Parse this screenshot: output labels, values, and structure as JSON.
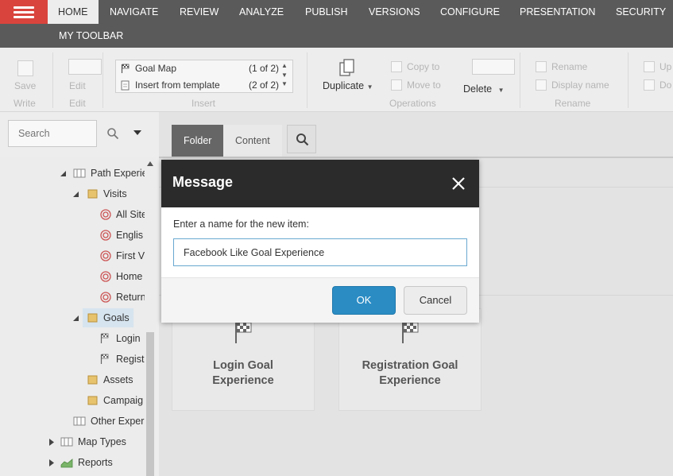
{
  "topbar": {
    "tabs": [
      "HOME",
      "NAVIGATE",
      "REVIEW",
      "ANALYZE",
      "PUBLISH",
      "VERSIONS",
      "CONFIGURE",
      "PRESENTATION",
      "SECURITY"
    ],
    "active_tab": "HOME",
    "my_toolbar": "MY TOOLBAR"
  },
  "ribbon": {
    "write": {
      "save_label": "Save",
      "group_label": "Write"
    },
    "edit": {
      "edit_label": "Edit",
      "group_label": "Edit"
    },
    "insert": {
      "items": [
        {
          "label": "Goal Map",
          "count": "(1 of 2)"
        },
        {
          "label": "Insert from template",
          "count": "(2 of 2)"
        }
      ],
      "group_label": "Insert"
    },
    "operations": {
      "duplicate_label": "Duplicate",
      "copy_to_label": "Copy to",
      "move_to_label": "Move to",
      "delete_label": "Delete",
      "group_label": "Operations"
    },
    "rename": {
      "rename_label": "Rename",
      "display_name_label": "Display name",
      "group_label": "Rename"
    },
    "partial": {
      "up_label": "Up",
      "down_label": "Do"
    }
  },
  "sidebar": {
    "search_placeholder": "Search",
    "tree": [
      {
        "label": "Path Experie",
        "icon": "path-map-icon"
      },
      {
        "label": "Visits",
        "icon": "folder-icon"
      },
      {
        "label": "All Site",
        "icon": "target-icon"
      },
      {
        "label": "Englis",
        "icon": "target-icon"
      },
      {
        "label": "First V",
        "icon": "target-icon"
      },
      {
        "label": "Home",
        "icon": "target-icon"
      },
      {
        "label": "Return",
        "icon": "target-icon"
      },
      {
        "label": "Goals",
        "icon": "folder-icon"
      },
      {
        "label": "Login",
        "icon": "flag-icon"
      },
      {
        "label": "Regist",
        "icon": "flag-icon"
      },
      {
        "label": "Assets",
        "icon": "folder-icon"
      },
      {
        "label": "Campaig",
        "icon": "folder-icon"
      },
      {
        "label": "Other Experi",
        "icon": "path-map-icon"
      },
      {
        "label": "Map Types",
        "icon": "path-map-icon"
      },
      {
        "label": "Reports",
        "icon": "chart-icon"
      }
    ]
  },
  "main": {
    "tabs": [
      "Folder",
      "Content"
    ],
    "active_tab": "Folder",
    "cards": [
      {
        "title_line1": "Login Goal",
        "title_line2": "Experience"
      },
      {
        "title_line1": "Registration Goal",
        "title_line2": "Experience"
      }
    ]
  },
  "modal": {
    "title": "Message",
    "prompt": "Enter a name for the new item:",
    "input_value": "Facebook Like Goal Experience",
    "ok_label": "OK",
    "cancel_label": "Cancel"
  },
  "colors": {
    "accent_red": "#d9443d",
    "topbar_gray": "#5a5a5a",
    "modal_header": "#2b2b2b",
    "primary_blue": "#2b8cc4"
  }
}
